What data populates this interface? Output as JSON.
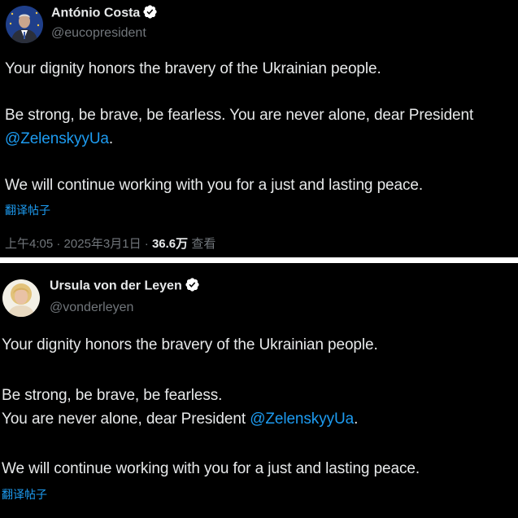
{
  "tweets": [
    {
      "author": "António Costa",
      "handle": "@eucopresident",
      "lines": [
        "Your dignity honors the bravery of the Ukrainian people.",
        "Be strong, be brave, be fearless. You are never alone, dear President",
        "@ZelenskyyUa",
        ".",
        "We will continue working with you for a just and lasting peace."
      ],
      "translate": "翻译帖子",
      "time": "上午4:05",
      "sep1": " · ",
      "date": "2025年3月1日",
      "sep2": " · ",
      "views": "36.6万",
      "views_label": " 查看"
    },
    {
      "author": "Ursula von der Leyen",
      "handle": "@vonderleyen",
      "lines": [
        "Your dignity honors the bravery of the Ukrainian people.",
        "Be strong, be brave, be fearless.",
        "You are never alone, dear President ",
        "@ZelenskyyUa",
        ".",
        "We will continue working with you for a just and lasting peace."
      ],
      "translate": "翻译帖子"
    }
  ],
  "colors": {
    "background": "#000000",
    "text": "#e7e9ea",
    "secondary": "#71767b",
    "link": "#1d9bf0"
  },
  "icons": [
    "verified-badge-icon"
  ]
}
